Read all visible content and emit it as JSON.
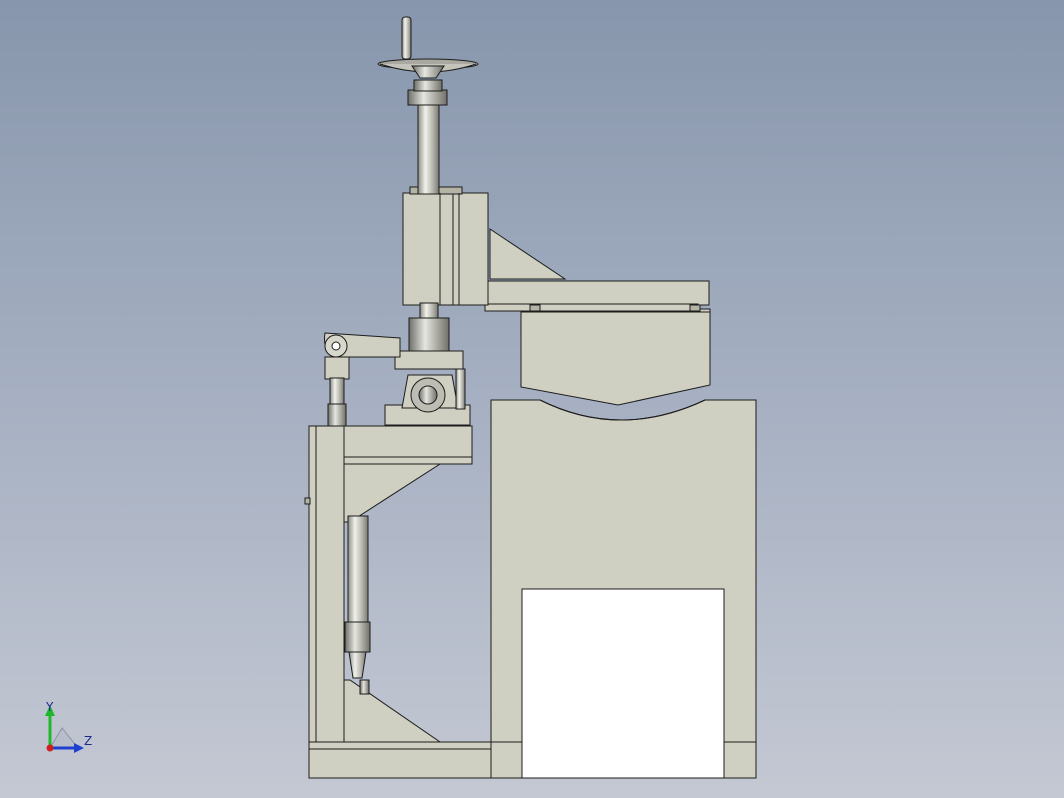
{
  "viewport": {
    "background_top": "#8796ac",
    "background_bottom": "#c4c8d3",
    "part_color": "#cfcfc2",
    "edge_color": "#1c1c1c"
  },
  "triad": {
    "y_label": "Y",
    "z_label": "Z",
    "y_color": "#1fb82a",
    "z_color": "#1f3fd0",
    "x_color": "#d01f1f"
  }
}
